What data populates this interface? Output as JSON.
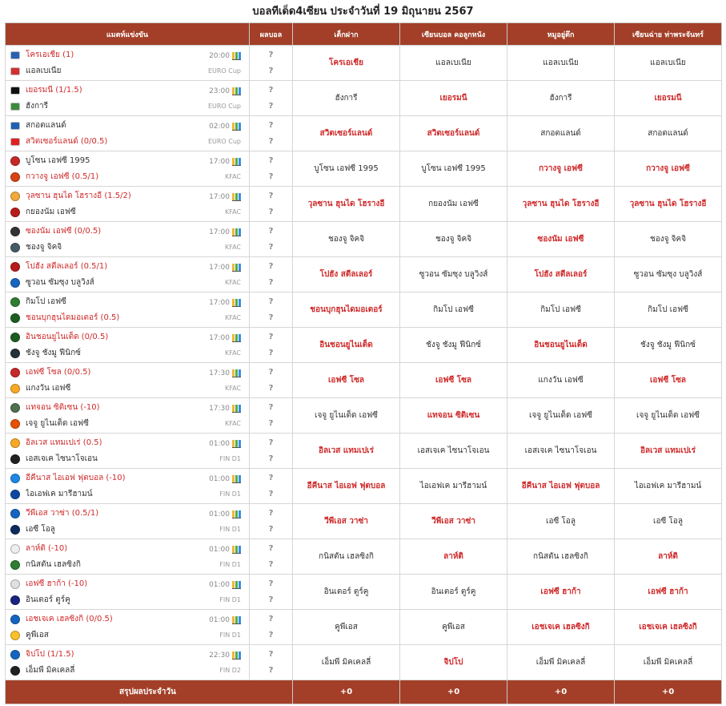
{
  "page_title": "บอลทีเด็ด4เซียน ประจำวันที่ 19 มิถุนายน 2567",
  "headers": [
    "แมตท์แข่งขัน",
    "ผลบอล",
    "เต็กฝาก",
    "เซียนบอล คอลูกหนัง",
    "หมูอยู่ตึก",
    "เซียนฉ่าย ท่าพระจันทร์"
  ],
  "score_placeholder": "?",
  "matches": [
    {
      "home": "โครเอเชีย (1)",
      "away": "แอลเบเนีย",
      "fav": "home",
      "time": "20:00",
      "league": "EURO Cup",
      "hc": "#2b5fb3",
      "ac": "#d32f2f",
      "tips": [
        {
          "t": "โครเอเชีย",
          "w": true
        },
        {
          "t": "แอลเบเนีย",
          "w": false
        },
        {
          "t": "แอลเบเนีย",
          "w": false
        },
        {
          "t": "แอลเบเนีย",
          "w": false
        }
      ]
    },
    {
      "home": "เยอรมนี (1/1.5)",
      "away": "ฮังการี",
      "fav": "home",
      "time": "23:00",
      "league": "EURO Cup",
      "hc": "#111111",
      "ac": "#3c8c3c",
      "tips": [
        {
          "t": "ฮังการี",
          "w": false
        },
        {
          "t": "เยอรมนี",
          "w": true
        },
        {
          "t": "ฮังการี",
          "w": false
        },
        {
          "t": "เยอรมนี",
          "w": true
        }
      ]
    },
    {
      "home": "สกอตแลนด์",
      "away": "สวิตเซอร์แลนด์ (0/0.5)",
      "fav": "away",
      "time": "02:00",
      "league": "EURO Cup",
      "hc": "#1f5fb5",
      "ac": "#e02020",
      "tips": [
        {
          "t": "สวิตเซอร์แลนด์",
          "w": true
        },
        {
          "t": "สวิตเซอร์แลนด์",
          "w": true
        },
        {
          "t": "สกอตแลนด์",
          "w": false
        },
        {
          "t": "สกอตแลนด์",
          "w": false
        }
      ]
    },
    {
      "home": "บูโซน เอฟซี 1995",
      "away": "กวางจู เอฟซี (0.5/1)",
      "fav": "away",
      "time": "17:00",
      "league": "KFAC",
      "hc": "#c62828",
      "ac": "#d84315",
      "tips": [
        {
          "t": "บูโซน เอฟซี 1995",
          "w": false
        },
        {
          "t": "บูโซน เอฟซี 1995",
          "w": false
        },
        {
          "t": "กวางจู เอฟซี",
          "w": true
        },
        {
          "t": "กวางจู เอฟซี",
          "w": true
        }
      ]
    },
    {
      "home": "วุลซาน ฮุนได โฮรางอี (1.5/2)",
      "away": "กยองนัม เอฟซี",
      "fav": "home",
      "time": "17:00",
      "league": "KFAC",
      "hc": "#f2a93b",
      "ac": "#b71c1c",
      "tips": [
        {
          "t": "วุลซาน ฮุนได โฮรางอี",
          "w": true
        },
        {
          "t": "กยองนัม เอฟซี",
          "w": false
        },
        {
          "t": "วุลซาน ฮุนได โฮรางอี",
          "w": true
        },
        {
          "t": "วุลซาน ฮุนได โฮรางอี",
          "w": true
        }
      ]
    },
    {
      "home": "ซองนัม เอฟซี (0/0.5)",
      "away": "ชองจู จิคจิ",
      "fav": "home",
      "time": "17:00",
      "league": "KFAC",
      "hc": "#333333",
      "ac": "#455a64",
      "tips": [
        {
          "t": "ชองจู จิคจิ",
          "w": false
        },
        {
          "t": "ชองจู จิคจิ",
          "w": false
        },
        {
          "t": "ซองนัม เอฟซี",
          "w": true
        },
        {
          "t": "ชองจู จิคจิ",
          "w": false
        }
      ]
    },
    {
      "home": "โปฮัง สตีลเลอร์ (0.5/1)",
      "away": "ซูวอน ซัมซุง บลูวิงส์",
      "fav": "home",
      "time": "17:00",
      "league": "KFAC",
      "hc": "#b71c1c",
      "ac": "#1565c0",
      "tips": [
        {
          "t": "โปฮัง สตีลเลอร์",
          "w": true
        },
        {
          "t": "ซูวอน ซัมซุง บลูวิงส์",
          "w": false
        },
        {
          "t": "โปฮัง สตีลเลอร์",
          "w": true
        },
        {
          "t": "ซูวอน ซัมซุง บลูวิงส์",
          "w": false
        }
      ]
    },
    {
      "home": "กิมโป เอฟซี",
      "away": "ชอนบุกฮุนไดมอเตอร์ (0.5)",
      "fav": "away",
      "time": "17:00",
      "league": "KFAC",
      "hc": "#2e7d32",
      "ac": "#1b5e20",
      "tips": [
        {
          "t": "ชอนบุกฮุนไดมอเตอร์",
          "w": true
        },
        {
          "t": "กิมโป เอฟซี",
          "w": false
        },
        {
          "t": "กิมโป เอฟซี",
          "w": false
        },
        {
          "t": "กิมโป เอฟซี",
          "w": false
        }
      ]
    },
    {
      "home": "อินชอนยูไนเต็ด (0/0.5)",
      "away": "ชังจู ชังมู ฟีนิกซ์",
      "fav": "home",
      "time": "17:00",
      "league": "KFAC",
      "hc": "#1b5e20",
      "ac": "#263238",
      "tips": [
        {
          "t": "อินชอนยูไนเต็ด",
          "w": true
        },
        {
          "t": "ชังจู ชังมู ฟีนิกซ์",
          "w": false
        },
        {
          "t": "อินชอนยูไนเต็ด",
          "w": true
        },
        {
          "t": "ชังจู ชังมู ฟีนิกซ์",
          "w": false
        }
      ]
    },
    {
      "home": "เอฟซี โซล (0/0.5)",
      "away": "แกงวัน เอฟซี",
      "fav": "home",
      "time": "17:30",
      "league": "KFAC",
      "hc": "#c62828",
      "ac": "#f9a825",
      "tips": [
        {
          "t": "เอฟซี โซล",
          "w": true
        },
        {
          "t": "เอฟซี โซล",
          "w": true
        },
        {
          "t": "แกงวัน เอฟซี",
          "w": false
        },
        {
          "t": "เอฟซี โซล",
          "w": true
        }
      ]
    },
    {
      "home": "แทจอน ซิติเซน (-10)",
      "away": "เจจู ยูไนเต็ด เอฟซี",
      "fav": "home",
      "time": "17:30",
      "league": "KFAC",
      "hc": "#4f6f4f",
      "ac": "#e65100",
      "tips": [
        {
          "t": "เจจู ยูไนเต็ด เอฟซี",
          "w": false
        },
        {
          "t": "แทจอน ซิติเซน",
          "w": true
        },
        {
          "t": "เจจู ยูไนเต็ด เอฟซี",
          "w": false
        },
        {
          "t": "เจจู ยูไนเต็ด เอฟซี",
          "w": false
        }
      ]
    },
    {
      "home": "อิลเวส แทมเปเร่ (0.5)",
      "away": "เอสเจเค ไซนาโจเอน",
      "fav": "home",
      "time": "01:00",
      "league": "FIN D1",
      "hc": "#f9a825",
      "ac": "#212121",
      "tips": [
        {
          "t": "อิลเวส แทมเปเร่",
          "w": true
        },
        {
          "t": "เอสเจเค ไซนาโจเอน",
          "w": false
        },
        {
          "t": "เอสเจเค ไซนาโจเอน",
          "w": false
        },
        {
          "t": "อิลเวส แทมเปเร่",
          "w": true
        }
      ]
    },
    {
      "home": "อีคีนาส ไอเอฟ ฟุตบอล (-10)",
      "away": "ไอเอฟเค มารีฮามน์",
      "fav": "home",
      "time": "01:00",
      "league": "FIN D1",
      "hc": "#1e88e5",
      "ac": "#0d47a1",
      "tips": [
        {
          "t": "อีคีนาส ไอเอฟ ฟุตบอล",
          "w": true
        },
        {
          "t": "ไอเอฟเค มารีฮามน์",
          "w": false
        },
        {
          "t": "อีคีนาส ไอเอฟ ฟุตบอล",
          "w": true
        },
        {
          "t": "ไอเอฟเค มารีฮามน์",
          "w": false
        }
      ]
    },
    {
      "home": "วีพีเอส วาซ่า (0.5/1)",
      "away": "เอซี โอลู",
      "fav": "home",
      "time": "01:00",
      "league": "FIN D1",
      "hc": "#1565c0",
      "ac": "#0d2b5e",
      "tips": [
        {
          "t": "วีพีเอส วาซ่า",
          "w": true
        },
        {
          "t": "วีพีเอส วาซ่า",
          "w": true
        },
        {
          "t": "เอซี โอลู",
          "w": false
        },
        {
          "t": "เอซี โอลู",
          "w": false
        }
      ]
    },
    {
      "home": "ลาห์ติ (-10)",
      "away": "กนิสตัน เฮลซิงกิ",
      "fav": "home",
      "time": "01:00",
      "league": "FIN D1",
      "hc": "#eeeeee",
      "ac": "#2e7d32",
      "tips": [
        {
          "t": "กนิสตัน เฮลซิงกิ",
          "w": false
        },
        {
          "t": "ลาห์ติ",
          "w": true
        },
        {
          "t": "กนิสตัน เฮลซิงกิ",
          "w": false
        },
        {
          "t": "ลาห์ติ",
          "w": true
        }
      ]
    },
    {
      "home": "เอฟซี ฮาก้า (-10)",
      "away": "อินเตอร์ ตูร์คู",
      "fav": "home",
      "time": "01:00",
      "league": "FIN D1",
      "hc": "#e0e0e0",
      "ac": "#1a237e",
      "tips": [
        {
          "t": "อินเตอร์ ตูร์คู",
          "w": false
        },
        {
          "t": "อินเตอร์ ตูร์คู",
          "w": false
        },
        {
          "t": "เอฟซี ฮาก้า",
          "w": true
        },
        {
          "t": "เอฟซี ฮาก้า",
          "w": true
        }
      ]
    },
    {
      "home": "เอชเจเค เฮลซิงกิ (0/0.5)",
      "away": "คูพีเอส",
      "fav": "home",
      "time": "01:00",
      "league": "FIN D1",
      "hc": "#1565c0",
      "ac": "#fbc02d",
      "tips": [
        {
          "t": "คูพีเอส",
          "w": false
        },
        {
          "t": "คูพีเอส",
          "w": false
        },
        {
          "t": "เอชเจเค เฮลซิงกิ",
          "w": true
        },
        {
          "t": "เอชเจเค เฮลซิงกิ",
          "w": true
        }
      ]
    },
    {
      "home": "จิปโป (1/1.5)",
      "away": "เอ็มพี มิคเคลลี่",
      "fav": "home",
      "time": "22:30",
      "league": "FIN D2",
      "hc": "#1565c0",
      "ac": "#212121",
      "tips": [
        {
          "t": "เอ็มพี มิคเคลลี่",
          "w": false
        },
        {
          "t": "จิปโป",
          "w": true
        },
        {
          "t": "เอ็มพี มิคเคลลี่",
          "w": false
        },
        {
          "t": "เอ็มพี มิคเคลลี่",
          "w": false
        }
      ]
    }
  ],
  "summary": {
    "label": "สรุปผลประจำวัน",
    "scores": [
      "+0",
      "+0",
      "+0",
      "+0"
    ]
  },
  "colors": {
    "header_bg": "#a33f28",
    "winner": "#cf2a2a"
  }
}
